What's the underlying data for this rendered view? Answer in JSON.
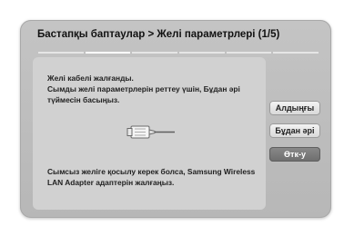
{
  "dialog": {
    "title": "Бастапқы баптаулар > Желі параметрлері (1/5)",
    "progress": {
      "segments": 6,
      "active_index": 1
    },
    "message_lines": [
      "Желі кабелі жалғанды.",
      "Сымды желі параметрлерін реттеу үшін, Бұдан әрі",
      "түймесін басыңыз."
    ],
    "note_lines": [
      "Сымсыз желіге қосылу керек болса, Samsung Wireless",
      "LAN Adapter адаптерін жалғаңыз."
    ],
    "buttons": {
      "previous": "Алдыңғы",
      "next": "Бұдан әрі",
      "skip": "Өтк-у"
    }
  }
}
